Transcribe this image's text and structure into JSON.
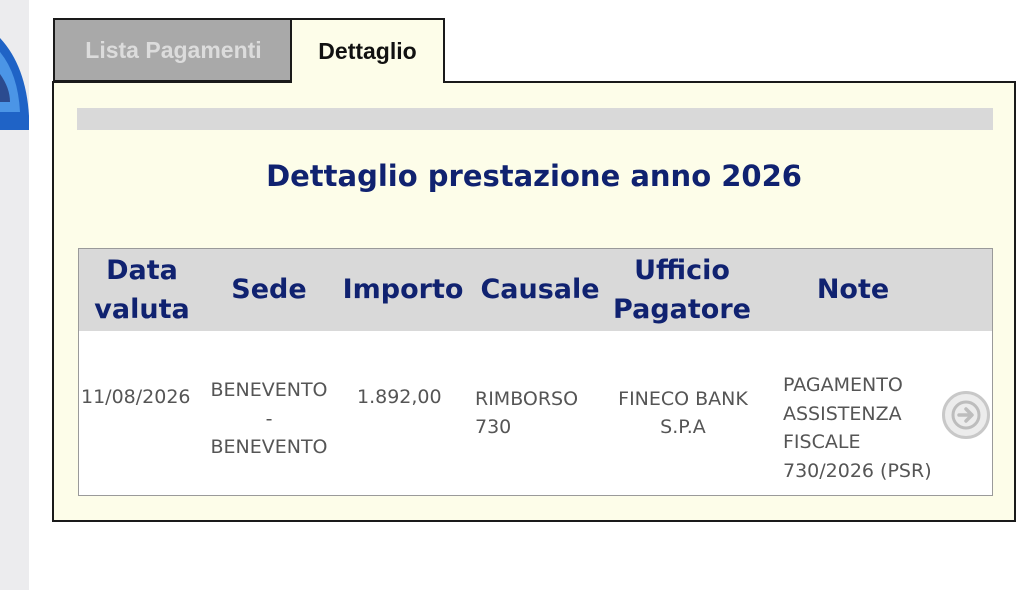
{
  "tabs": [
    {
      "label": "Lista Pagamenti",
      "active": false
    },
    {
      "label": "Dettaglio",
      "active": true
    }
  ],
  "detail": {
    "title": "Dettaglio prestazione anno 2026"
  },
  "table": {
    "headers": {
      "data_valuta": "Data valuta",
      "sede": "Sede",
      "importo": "Importo",
      "causale": "Causale",
      "ufficio_pagatore": "Ufficio Pagatore",
      "note": "Note"
    },
    "rows": [
      {
        "data_valuta": "11/08/2026",
        "sede": "BENEVENTO - BENEVENTO",
        "importo": "1.892,00",
        "causale": "RIMBORSO 730",
        "ufficio_pagatore": "FINECO BANK S.P.A",
        "note": "PAGAMENTO ASSISTENZA FISCALE 730/2026 (PSR)"
      }
    ]
  },
  "icons": {
    "row_action": "arrow-right-circle-icon",
    "logo": "logo-fragment"
  },
  "colors": {
    "header_text": "#102270",
    "panel_background": "#fdfde9",
    "table_header_background": "#d9d9d9",
    "inactive_tab": "#a9a9a9",
    "cell_text": "#555555"
  }
}
